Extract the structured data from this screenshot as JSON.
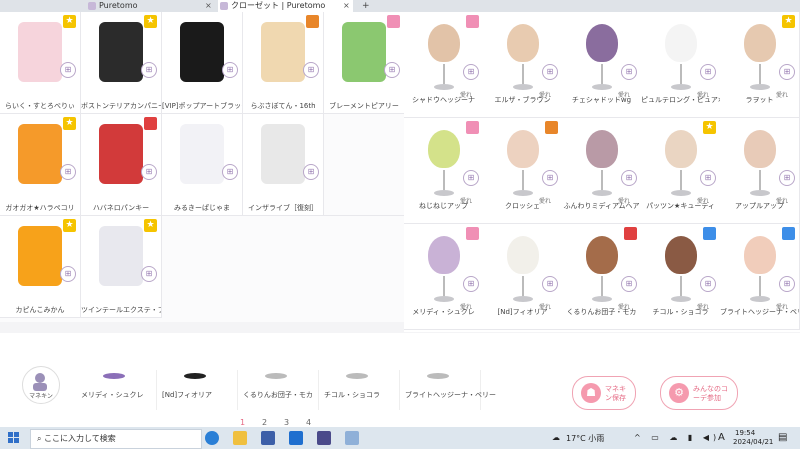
{
  "browser": {
    "tabs": [
      {
        "label": "Puretomo",
        "active": false
      },
      {
        "label": "クローゼット | Puretomo",
        "active": true
      }
    ],
    "new_tab": "+",
    "close_symbol": "×"
  },
  "left_grid": {
    "items": [
      {
        "label": "らいく・すとろべりぃ"
      },
      {
        "label": "ボストンテリアカンパニー"
      },
      {
        "label": "[VIP]ポップアートブラック"
      },
      {
        "label": "らぶさぼてん・16th"
      },
      {
        "label": "ブレーメントピアリー"
      },
      {
        "label": "ガオガオ★ハラペコリ"
      },
      {
        "label": "ハバネロパンキー"
      },
      {
        "label": "みるきーぱじゃま"
      },
      {
        "label": "インザライブ［復刻］"
      },
      {
        "label": ""
      },
      {
        "label": "カピんこみかん"
      },
      {
        "label": "ツインテールエクステ・ブルー"
      }
    ]
  },
  "right_grid": {
    "items": [
      {
        "label": "シャドウヘッジーナ"
      },
      {
        "label": "エルザ・ブラウン"
      },
      {
        "label": "チェシャドットwg"
      },
      {
        "label": "ピュルテロング・ピュアホワイト"
      },
      {
        "label": "ラヲット"
      },
      {
        "label": "ねじねじアップ"
      },
      {
        "label": "クロッシェ"
      },
      {
        "label": "ふんわりミディアムヘア"
      },
      {
        "label": "パッツン★キューティ"
      },
      {
        "label": "アップルアップ"
      },
      {
        "label": "メリディ・シュクレ"
      },
      {
        "label": "[Nd]フィオリア"
      },
      {
        "label": "くるりんお団子・モカ"
      },
      {
        "label": "チコル・ショコラ"
      },
      {
        "label": "ブライトヘッジーナ・ベリー"
      }
    ],
    "likes_label": "愛れ"
  },
  "bottom_strip": {
    "items": [
      {
        "label": "メリディ・シュクレ"
      },
      {
        "label": "[Nd]フィオリア"
      },
      {
        "label": "くるりんお団子・モカ"
      },
      {
        "label": "チコル・ショコラ"
      },
      {
        "label": "ブライトヘッジーナ・ベリー"
      }
    ],
    "mannequin_label": "マネキン"
  },
  "actions": {
    "mannequin_save": "マネキン保存",
    "coordinate_join": "みんなのコーデ参加"
  },
  "pager": {
    "pages": [
      "1",
      "2",
      "3",
      "4"
    ],
    "current": "1"
  },
  "taskbar": {
    "search_placeholder": "ここに入力して検索",
    "weather": "17°C 小雨",
    "ime": "A",
    "time": "19:54",
    "date": "2024/04/21"
  },
  "colors": {
    "accent": "#e56a84",
    "star": "#f5c400",
    "taskbar": "#dde6ee"
  }
}
